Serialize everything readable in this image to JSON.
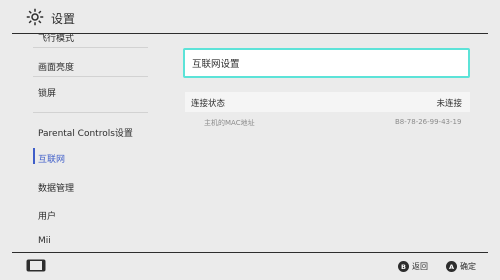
{
  "header": {
    "title": "设置",
    "icon": "gear-icon"
  },
  "sidebar": {
    "items": [
      {
        "label": "飞行模式"
      },
      {
        "label": "画面亮度"
      },
      {
        "label": "锁屏"
      },
      {
        "label": "Parental Controls设置"
      },
      {
        "label": "互联网",
        "selected": true
      },
      {
        "label": "数据管理"
      },
      {
        "label": "用户"
      },
      {
        "label": "Mii"
      }
    ]
  },
  "main": {
    "internet_settings_label": "互联网设置",
    "connection_status_label": "连接状态",
    "connection_status_value": "未连接",
    "mac_label": "主机的MAC地址",
    "mac_value": "B8-78-26-99-43-19"
  },
  "footer": {
    "console_icon": "console-icon",
    "back": {
      "key": "B",
      "label": "返回"
    },
    "ok": {
      "key": "A",
      "label": "确定"
    }
  },
  "colors": {
    "accent": "#3f5ec9",
    "focus": "#5ce3d8",
    "background": "#ebebeb"
  }
}
